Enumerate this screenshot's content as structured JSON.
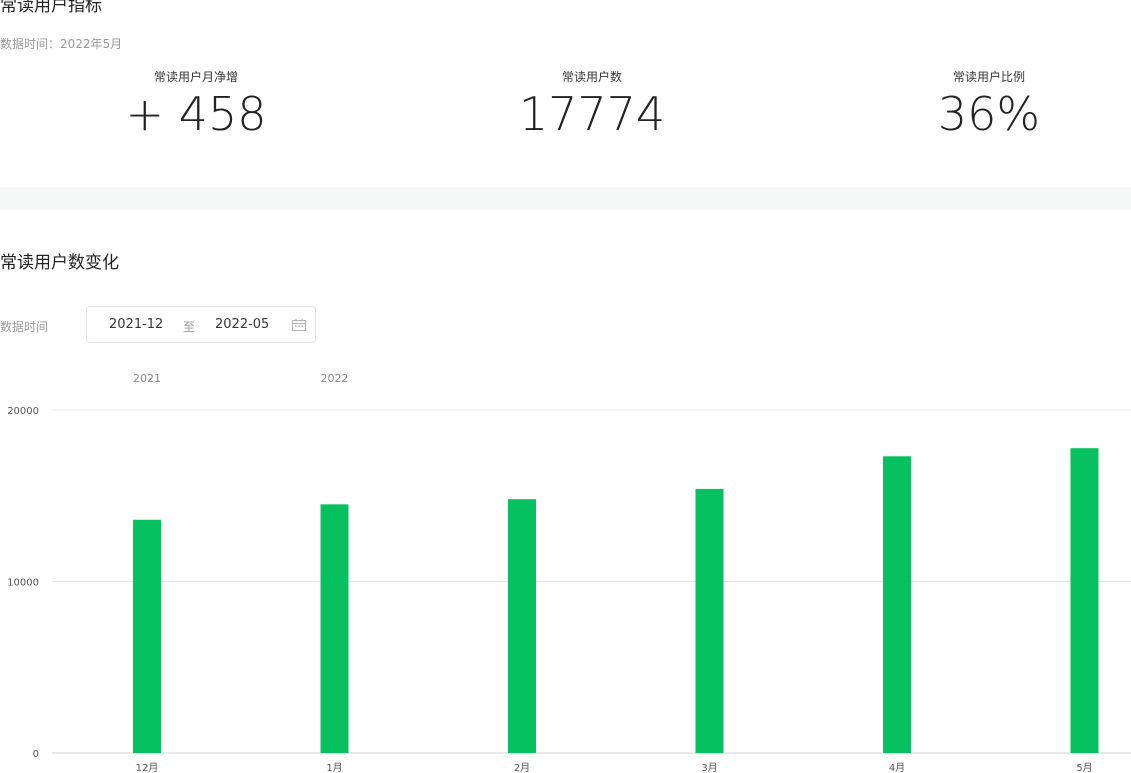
{
  "metrics_section": {
    "title": "常读用户指标",
    "data_time": "数据时间：2022年5月",
    "metrics": [
      {
        "label": "常读用户月净增",
        "value": "+ 458"
      },
      {
        "label": "常读用户数",
        "value": "17774"
      },
      {
        "label": "常读用户比例",
        "value": "36%"
      }
    ]
  },
  "trend_section": {
    "title": "常读用户数变化",
    "range_label": "数据时间",
    "start_date": "2021-12",
    "separator": "至",
    "end_date": "2022-05",
    "calendar_icon": "calendar-icon"
  },
  "colors": {
    "bar": "#07c160",
    "grid": "#e8e8e8",
    "band": "#f6f7f7"
  },
  "chart_data": {
    "type": "bar",
    "categories": [
      "12月",
      "1月",
      "2月",
      "3月",
      "4月",
      "5月"
    ],
    "year_labels": [
      {
        "label": "2021",
        "category_index": 0
      },
      {
        "label": "2022",
        "category_index": 1
      }
    ],
    "values": [
      13600,
      14500,
      14800,
      15400,
      17300,
      17774
    ],
    "ylim": [
      0,
      20000
    ],
    "yticks": [
      0,
      10000,
      20000
    ],
    "grid": true,
    "legend": "none"
  }
}
